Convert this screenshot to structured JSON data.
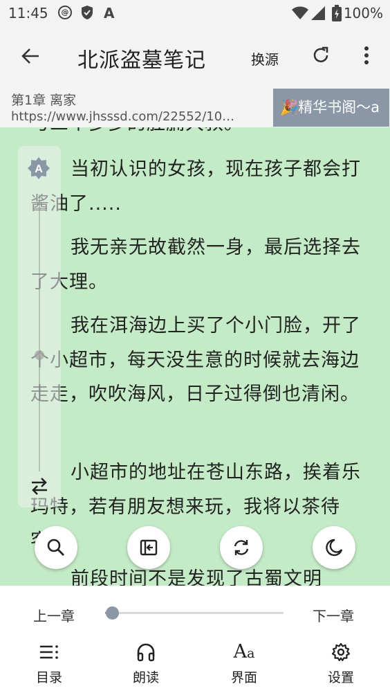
{
  "status_bar": {
    "time": "11:45",
    "battery": "100%",
    "icons": [
      "sync-badge-icon",
      "shield-icon",
      "a-icon",
      "wifi-icon",
      "signal-icon",
      "battery-icon"
    ]
  },
  "appbar": {
    "title": "北派盗墓笔记",
    "switch_source": "换源"
  },
  "chapter": {
    "title": "第1章 离家",
    "url": "https://www.jhsssd.com/22552/10…",
    "source_tag": "🎉精华书阁〜a"
  },
  "content": {
    "paragraphs": [
      "与三个多多的肚腩大叔。",
      "当初认识的女孩，现在孩子都会打酱油了.....",
      "我无亲无故截然一身，最后选择去了大理。",
      "我在洱海边上买了个小门脸，开了个小超市，每天没生意的时候就去海边走走，吹吹海风，日子过得倒也清闲。",
      "小超市的地址在苍山东路，挨着乐玛特，若有朋友想来玩，我将以茶待客。",
      "前段时间不是发现了古蜀文明"
    ]
  },
  "side_panel": {
    "auto_brightness_label": "A",
    "brightness_level": 0.42
  },
  "actions": {
    "icons": [
      "search-icon",
      "auto-page-icon",
      "replace-icon",
      "night-mode-icon"
    ]
  },
  "bottom": {
    "prev_chapter": "上一章",
    "next_chapter": "下一章",
    "progress": 0.04,
    "nav": [
      {
        "label": "目录",
        "icon": "catalog-icon"
      },
      {
        "label": "朗读",
        "icon": "headphones-icon"
      },
      {
        "label": "界面",
        "icon": "font-icon"
      },
      {
        "label": "设置",
        "icon": "gear-icon"
      }
    ]
  },
  "colors": {
    "reader_bg": "#c3ebc5",
    "accent": "#8a97a6",
    "bar_bg": "#f3f3f3"
  }
}
